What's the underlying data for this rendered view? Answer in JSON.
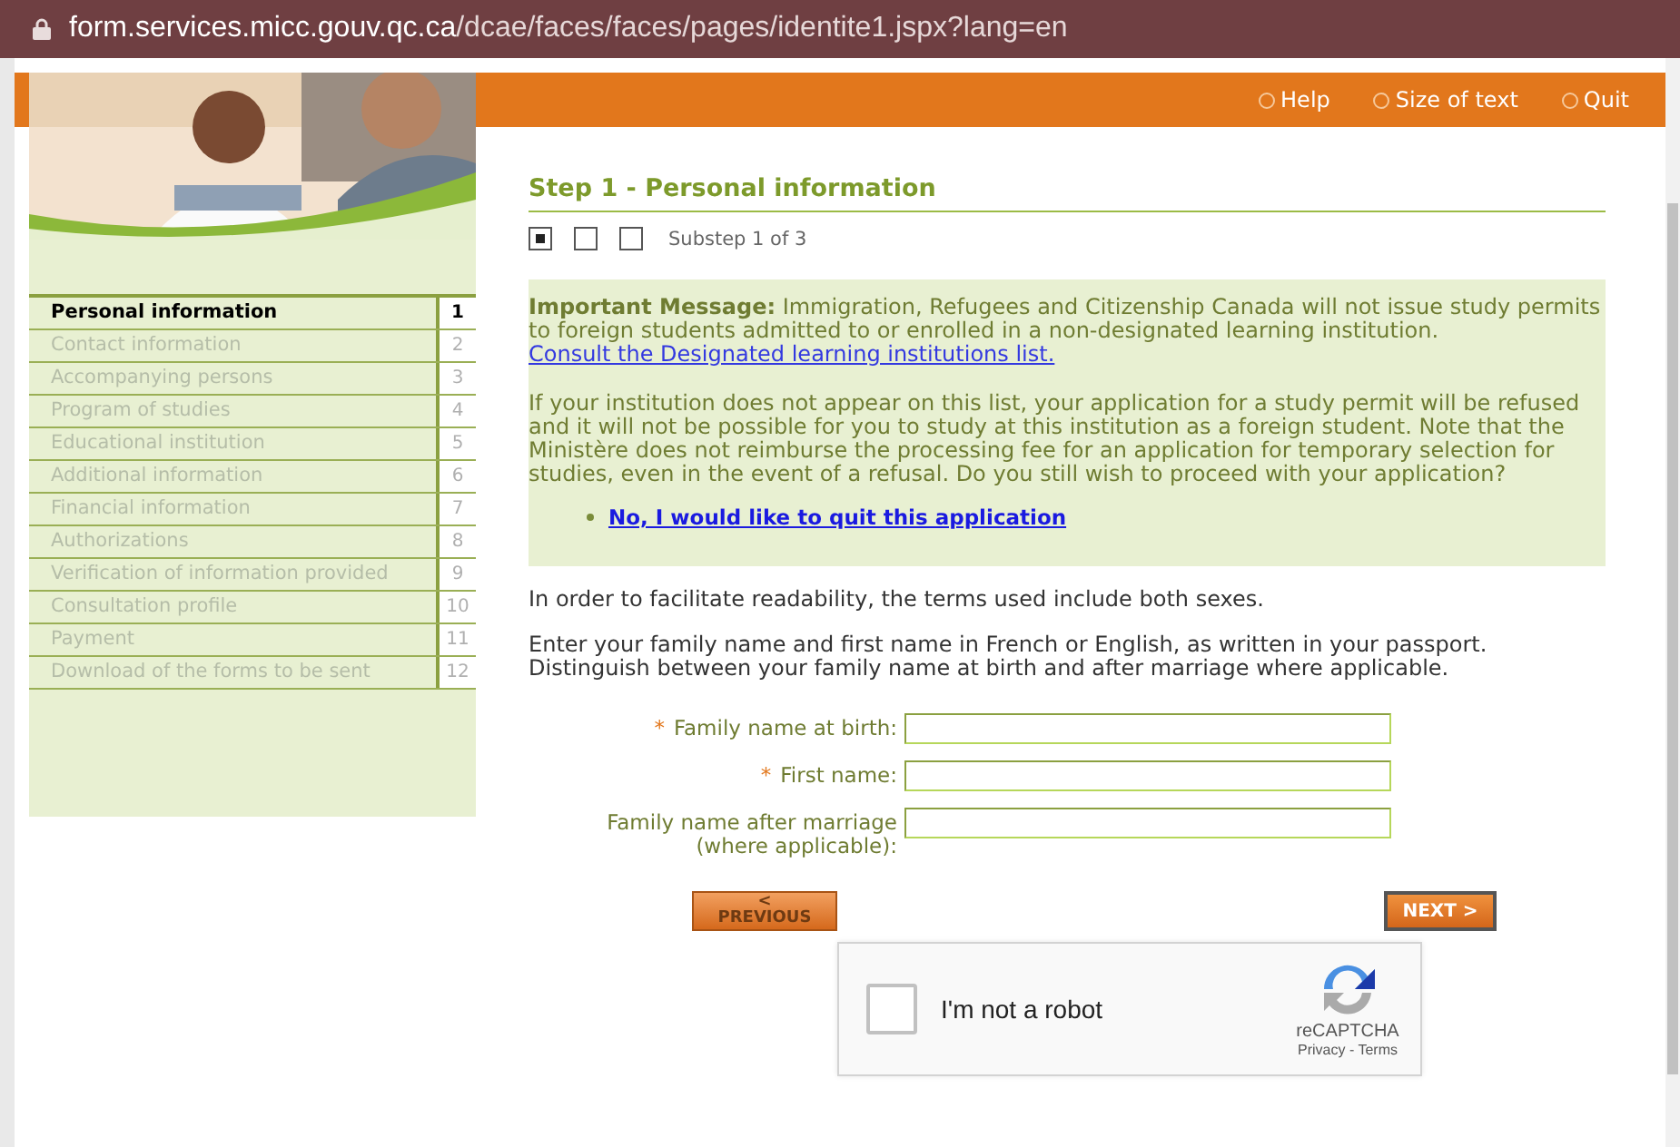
{
  "address_bar": {
    "host": "form.services.micc.gouv.qc.ca",
    "path": "/dcae/faces/faces/pages/identite1.jspx?lang=en"
  },
  "top_links": [
    {
      "label": "Help"
    },
    {
      "label": "Size of text"
    },
    {
      "label": "Quit"
    }
  ],
  "header_photo": {
    "kind": "picture"
  },
  "steps": [
    {
      "label": "Personal information",
      "number": "1",
      "selected": true
    },
    {
      "label": "Contact information",
      "number": "2",
      "selected": false
    },
    {
      "label": "Accompanying persons",
      "number": "3",
      "selected": false
    },
    {
      "label": "Program of studies",
      "number": "4",
      "selected": false
    },
    {
      "label": "Educational institution",
      "number": "5",
      "selected": false
    },
    {
      "label": "Additional information",
      "number": "6",
      "selected": false
    },
    {
      "label": "Financial information",
      "number": "7",
      "selected": false
    },
    {
      "label": "Authorizations",
      "number": "8",
      "selected": false
    },
    {
      "label": "Verification of information provided",
      "number": "9",
      "selected": false
    },
    {
      "label": "Consultation profile",
      "number": "10",
      "selected": false
    },
    {
      "label": "Payment",
      "number": "11",
      "selected": false
    },
    {
      "label": "Download of the forms to be sent",
      "number": "12",
      "selected": false
    }
  ],
  "heading": "Step 1 - Personal information",
  "substeps": {
    "boxes": [
      {
        "checked": true
      },
      {
        "checked": false
      },
      {
        "checked": false
      }
    ],
    "label": "Substep 1 of 3"
  },
  "message": {
    "title": "Important Message:",
    "text": "Immigration, Refugees and Citizenship Canada will not issue study permits to foreign students admitted to or enrolled in a non-designated learning institution.",
    "link": "Consult the Designated learning institutions list.",
    "warning": "If your institution does not appear on this list, your application for a study permit will be refused and it will not be possible for you to study at this institution as a foreign student. Note that the Ministère does not reimburse the processing fee for an application for temporary selection for studies, even in the event of a refusal. Do you still wish to proceed with your application?",
    "quit_link": "No, I would like to quit this application"
  },
  "notes": [
    "In order to facilitate readability, the terms used include both sexes.",
    "Enter your family name and first name in French or English, as written in your passport. Distinguish between your family name at birth and after marriage where applicable."
  ],
  "required_mark": "*",
  "fields": [
    {
      "label": "Family name at birth:",
      "required": true
    },
    {
      "label": "First name:",
      "required": true
    },
    {
      "label": "Family name after marriage (where applicable):",
      "required": false
    }
  ],
  "previous_button": {
    "arrow": "<",
    "label": "PREVIOUS"
  },
  "next_button": "NEXT >",
  "captcha": {
    "label": "I'm not a robot",
    "checked": false,
    "brand": "reCAPTCHA",
    "links": [
      "Privacy",
      "Terms"
    ],
    "separator": "-"
  }
}
